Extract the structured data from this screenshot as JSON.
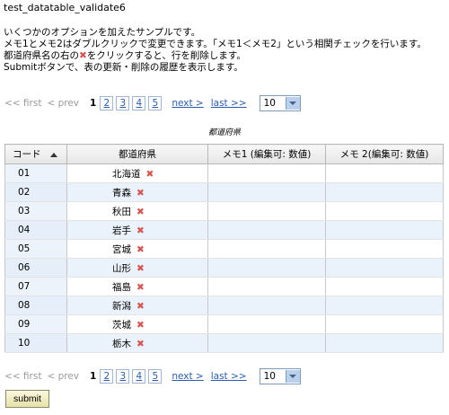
{
  "title": "test_datatable_validate6",
  "description": {
    "line1": "いくつかのオプションを加えたサンプルです。",
    "line2": "メモ1とメモ2はダブルクリックで変更できます。「メモ1＜メモ2」という相関チェックを行います。",
    "line3a": "都道府県名の右の",
    "line3b": "をクリックすると、行を削除します。",
    "line4": "Submitボタンで、表の更新・削除の履歴を表示します。"
  },
  "pager": {
    "first": "<< first",
    "prev": "< prev",
    "current": "1",
    "pages": [
      "2",
      "3",
      "4",
      "5"
    ],
    "next": "next >",
    "last": "last >>",
    "page_size": "10"
  },
  "table": {
    "caption": "都道府県",
    "headers": [
      "コード",
      "都道府県",
      "メモ1 (編集可: 数値)",
      "メモ 2(編集可: 数値)"
    ],
    "rows": [
      {
        "code": "01",
        "pref": "北海道"
      },
      {
        "code": "02",
        "pref": "青森"
      },
      {
        "code": "03",
        "pref": "秋田"
      },
      {
        "code": "04",
        "pref": "岩手"
      },
      {
        "code": "05",
        "pref": "宮城"
      },
      {
        "code": "06",
        "pref": "山形"
      },
      {
        "code": "07",
        "pref": "福島"
      },
      {
        "code": "08",
        "pref": "新潟"
      },
      {
        "code": "09",
        "pref": "茨城"
      },
      {
        "code": "10",
        "pref": "栃木"
      }
    ],
    "delete_glyph": "✖",
    "accent": "#d9534f"
  },
  "submit_label": "submit"
}
